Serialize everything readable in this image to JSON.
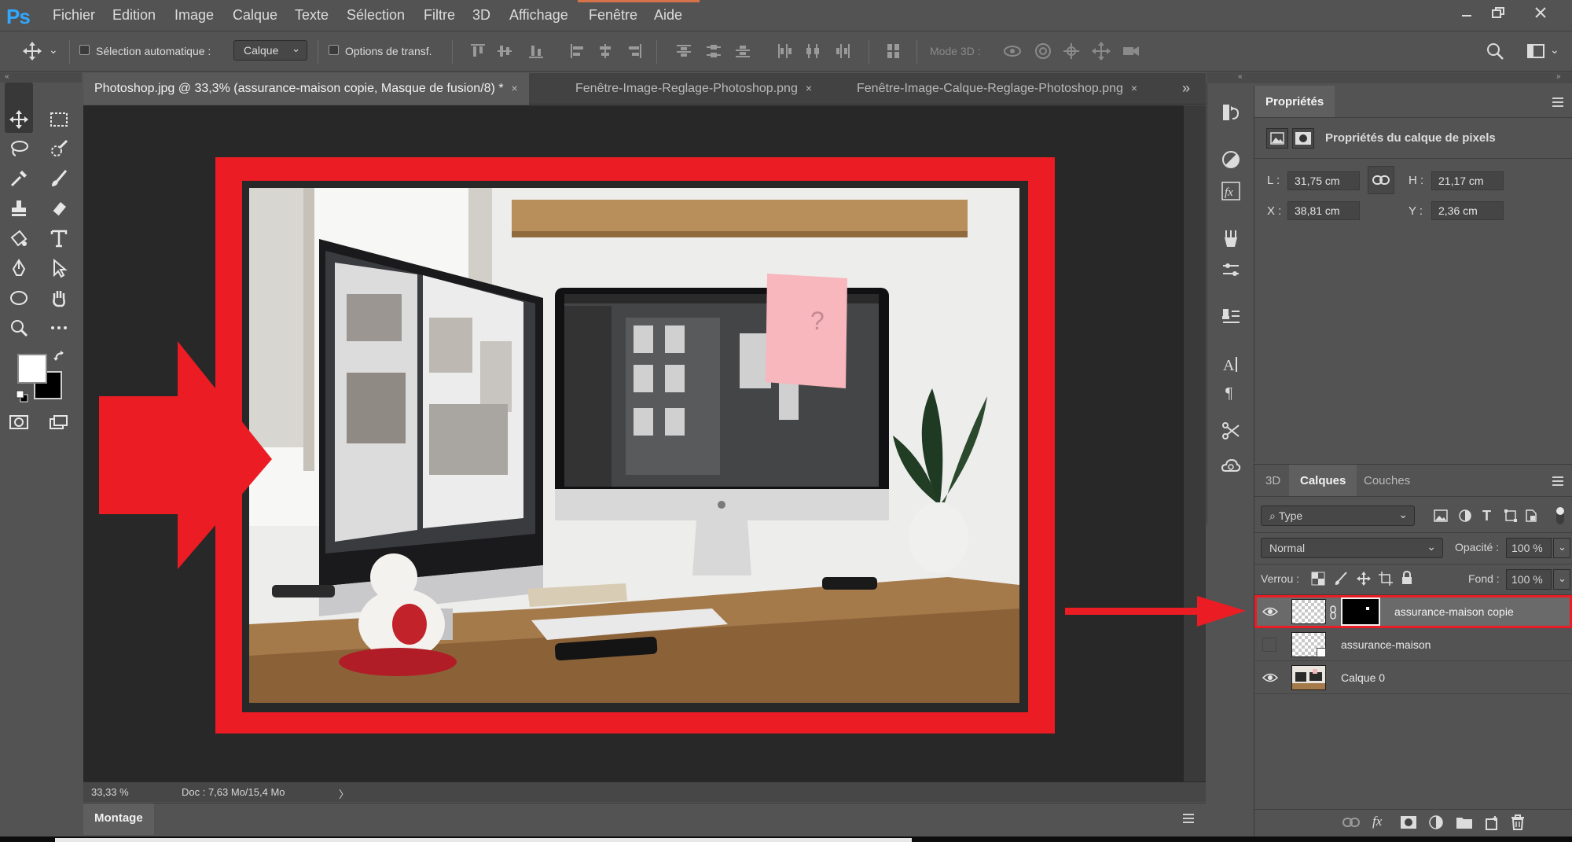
{
  "app": {
    "logo": "Ps"
  },
  "menu": [
    "Fichier",
    "Edition",
    "Image",
    "Calque",
    "Texte",
    "Sélection",
    "Filtre",
    "3D",
    "Affichage",
    "Fenêtre",
    "Aide"
  ],
  "options_bar": {
    "auto_select_label": "Sélection automatique :",
    "auto_select_value": "Calque",
    "transform_label": "Options de transf.",
    "mode3d_label": "Mode 3D :"
  },
  "panel_collapse": "«",
  "panel_expand": "»",
  "tabs": [
    {
      "label": "Photoshop.jpg @ 33,3% (assurance-maison copie, Masque de fusion/8) *",
      "close": "×"
    },
    {
      "label": "Fenêtre-Image-Reglage-Photoshop.png",
      "close": "×"
    },
    {
      "label": "Fenêtre-Image-Calque-Reglage-Photoshop.png",
      "close": "×"
    }
  ],
  "status": {
    "zoom": "33,33 %",
    "doc": "Doc : 7,63 Mo/15,4 Mo",
    "arrow": "〉"
  },
  "montage_label": "Montage",
  "properties": {
    "tab": "Propriétés",
    "header": "Propriétés du calque de pixels",
    "w_label": "L :",
    "w_value": "31,75 cm",
    "h_label": "H :",
    "h_value": "21,17 cm",
    "x_label": "X :",
    "x_value": "38,81 cm",
    "y_label": "Y :",
    "y_value": "2,36 cm"
  },
  "layers_panel": {
    "tabs": [
      "3D",
      "Calques",
      "Couches"
    ],
    "active_tab": "Calques",
    "filter_label": "Type",
    "blend_mode": "Normal",
    "opacity_label": "Opacité :",
    "opacity_value": "100 %",
    "lock_label": "Verrou :",
    "fill_label": "Fond :",
    "fill_value": "100 %",
    "layers": [
      {
        "name": "assurance-maison copie",
        "visible": true,
        "selected": true
      },
      {
        "name": "assurance-maison",
        "visible": false,
        "selected": false
      },
      {
        "name": "Calque 0",
        "visible": true,
        "selected": false
      }
    ]
  },
  "colors": {
    "highlight_red": "#ec1c24",
    "ps_blue": "#31a8ff",
    "ui_gray": "#535353",
    "canvas_bg": "#282828"
  },
  "icons": [
    "move-icon",
    "marquee-icon",
    "lasso-icon",
    "quick-select-icon",
    "eyedropper-icon",
    "brush-icon",
    "stamp-icon",
    "eraser-icon",
    "gradient-icon",
    "text-icon",
    "pen-icon",
    "path-select-icon",
    "ellipse-icon",
    "hand-icon",
    "zoom-icon",
    "more-icon",
    "search-icon",
    "workspace-icon"
  ]
}
